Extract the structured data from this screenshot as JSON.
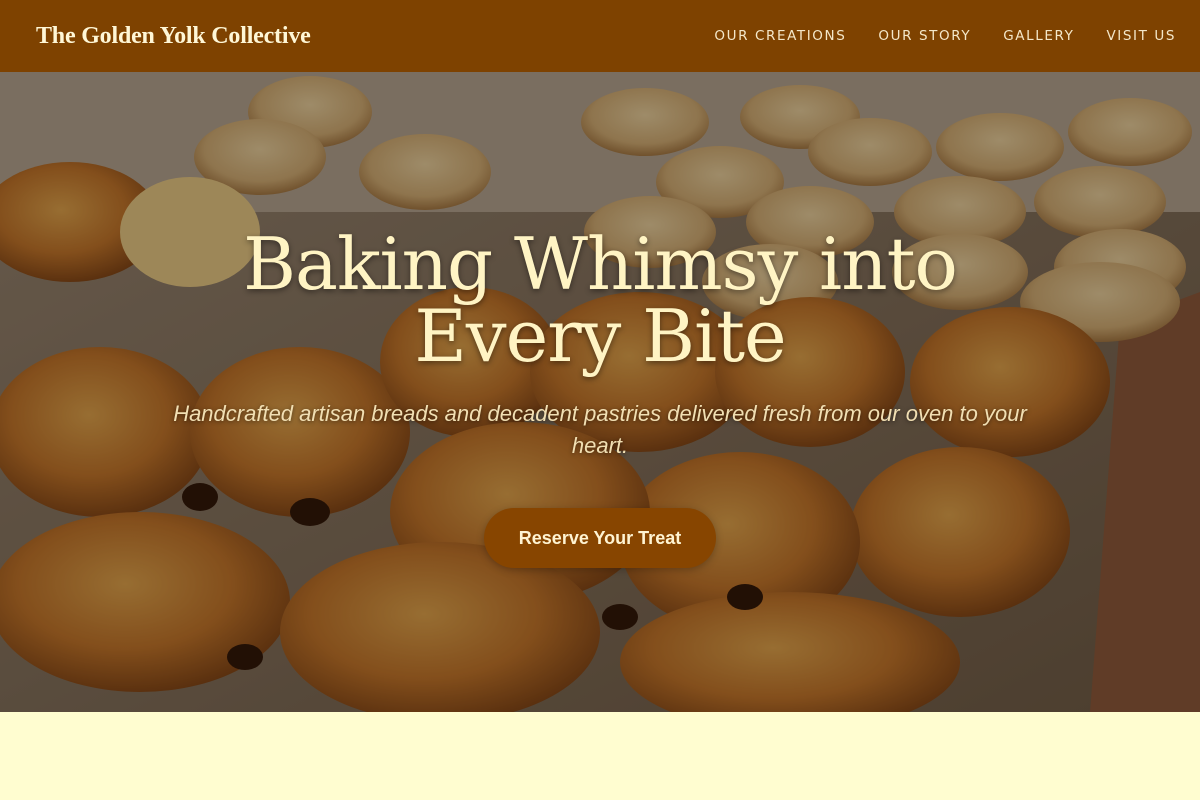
{
  "header": {
    "brand": "The Golden Yolk Collective",
    "nav": [
      "OUR CREATIONS",
      "OUR STORY",
      "GALLERY",
      "VISIT US"
    ]
  },
  "hero": {
    "title": "Baking Whimsy into Every Bite",
    "subtitle": "Handcrafted artisan breads and decadent pastries delivered fresh from our oven to your heart.",
    "cta_label": "Reserve Your Treat"
  },
  "colors": {
    "header_bg": "#7e4200",
    "cta_bg": "#874500",
    "page_bg": "#fffdd0",
    "title_text": "#fff4c4"
  }
}
